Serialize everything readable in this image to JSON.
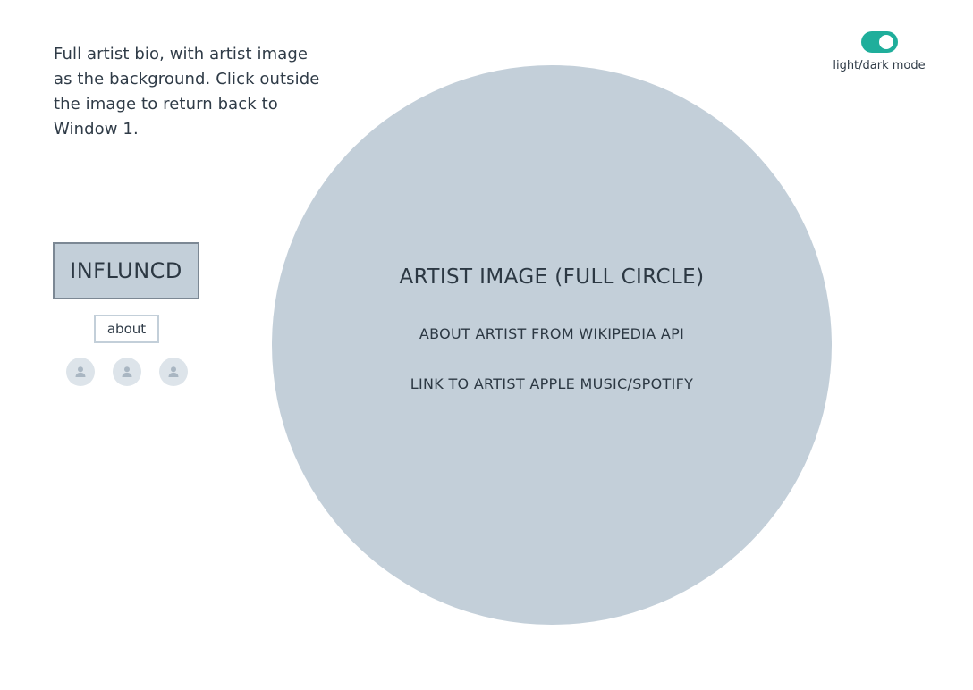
{
  "note": {
    "text": "Full artist bio, with artist image as the background. Click outside the image to return back to Window 1."
  },
  "theme_toggle": {
    "label": "light/dark mode",
    "state": "on",
    "accent_color": "#1fae9b"
  },
  "sidebar": {
    "logo_text": "INFLUNCD",
    "about_label": "about",
    "avatars": [
      {
        "icon": "user-icon"
      },
      {
        "icon": "user-icon"
      },
      {
        "icon": "user-icon"
      }
    ]
  },
  "artist_circle": {
    "title": "ARTIST IMAGE (FULL CIRCLE)",
    "about_text": "ABOUT ARTIST FROM WIKIPEDIA API",
    "link_text": "LINK TO ARTIST APPLE MUSIC/SPOTIFY",
    "fill_color": "#c3cfd9"
  }
}
